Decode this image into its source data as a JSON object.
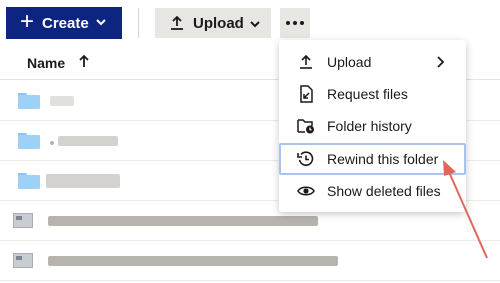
{
  "toolbar": {
    "create_label": "Create",
    "upload_label": "Upload"
  },
  "table": {
    "column_name": "Name",
    "sort_direction": "ascending"
  },
  "menu": {
    "items": [
      {
        "label": "Upload",
        "icon": "upload-icon",
        "has_submenu": true
      },
      {
        "label": "Request files",
        "icon": "request-files-icon"
      },
      {
        "label": "Folder history",
        "icon": "folder-history-icon"
      },
      {
        "label": "Rewind this folder",
        "icon": "rewind-icon",
        "highlighted": true
      },
      {
        "label": "Show deleted files",
        "icon": "eye-icon"
      }
    ]
  },
  "colors": {
    "create_button": "#0d2481",
    "folder": "#9fd0f5",
    "highlight_outline": "#a8c3ef",
    "annotation_arrow": "#e0685b"
  }
}
